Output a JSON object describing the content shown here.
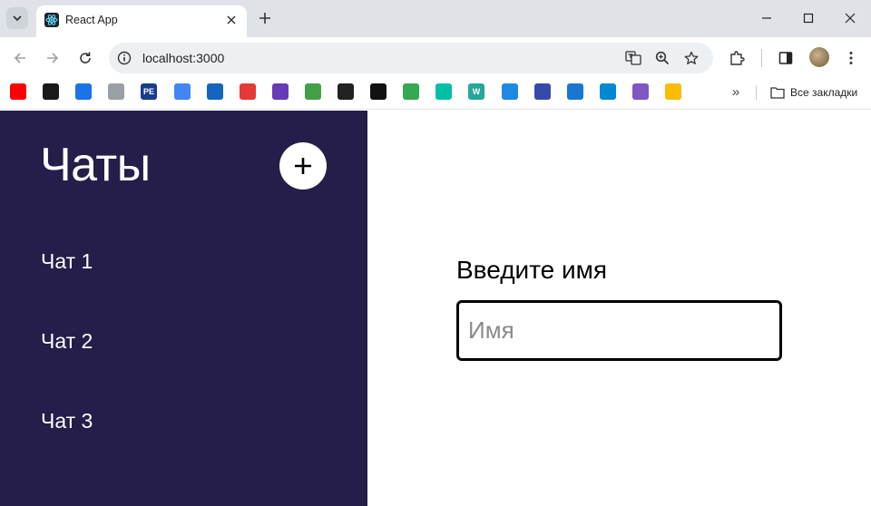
{
  "browser": {
    "tab_title": "React App",
    "url": "localhost:3000",
    "bookmarks_all_label": "Все закладки",
    "bookmarks": [
      {
        "icon": "youtube-icon",
        "color": "#ff0000"
      },
      {
        "icon": "chart-bars-icon",
        "color": "#1a1a1a"
      },
      {
        "icon": "message-icon",
        "color": "#1a73e8"
      },
      {
        "icon": "save-disk-icon",
        "color": "#9aa0a6"
      },
      {
        "icon": "pe-ru-icon",
        "color": "#1b3b8c",
        "text": "PE"
      },
      {
        "icon": "translate-icon",
        "color": "#4285f4"
      },
      {
        "icon": "wave-icon",
        "color": "#1565c0"
      },
      {
        "icon": "star-red-icon",
        "color": "#e53935"
      },
      {
        "icon": "colorful-icon",
        "color": "#673ab7"
      },
      {
        "icon": "leaf-icon",
        "color": "#43a047"
      },
      {
        "icon": "notion-icon",
        "color": "#222222"
      },
      {
        "icon": "github-icon",
        "color": "#111111"
      },
      {
        "icon": "plus-green-icon",
        "color": "#34a853"
      },
      {
        "icon": "vector-icon",
        "color": "#00bfa5"
      },
      {
        "icon": "w-icon",
        "color": "#26a69a",
        "text": "W"
      },
      {
        "icon": "robot-icon",
        "color": "#1e88e5"
      },
      {
        "icon": "floppy-icon",
        "color": "#3949ab"
      },
      {
        "icon": "diamond-icon",
        "color": "#1976d2"
      },
      {
        "icon": "box-icon",
        "color": "#0288d1"
      },
      {
        "icon": "mgu-icon",
        "color": "#7e57c2"
      },
      {
        "icon": "drive-icon",
        "color": "#fbbc04"
      }
    ]
  },
  "sidebar": {
    "title": "Чаты",
    "add_label": "+",
    "chats": [
      "Чат 1",
      "Чат 2",
      "Чат 3"
    ]
  },
  "main": {
    "name_label": "Введите имя",
    "name_placeholder": "Имя",
    "name_value": ""
  },
  "colors": {
    "sidebar_bg": "#251d4a",
    "text_on_sidebar": "#ffffff"
  }
}
